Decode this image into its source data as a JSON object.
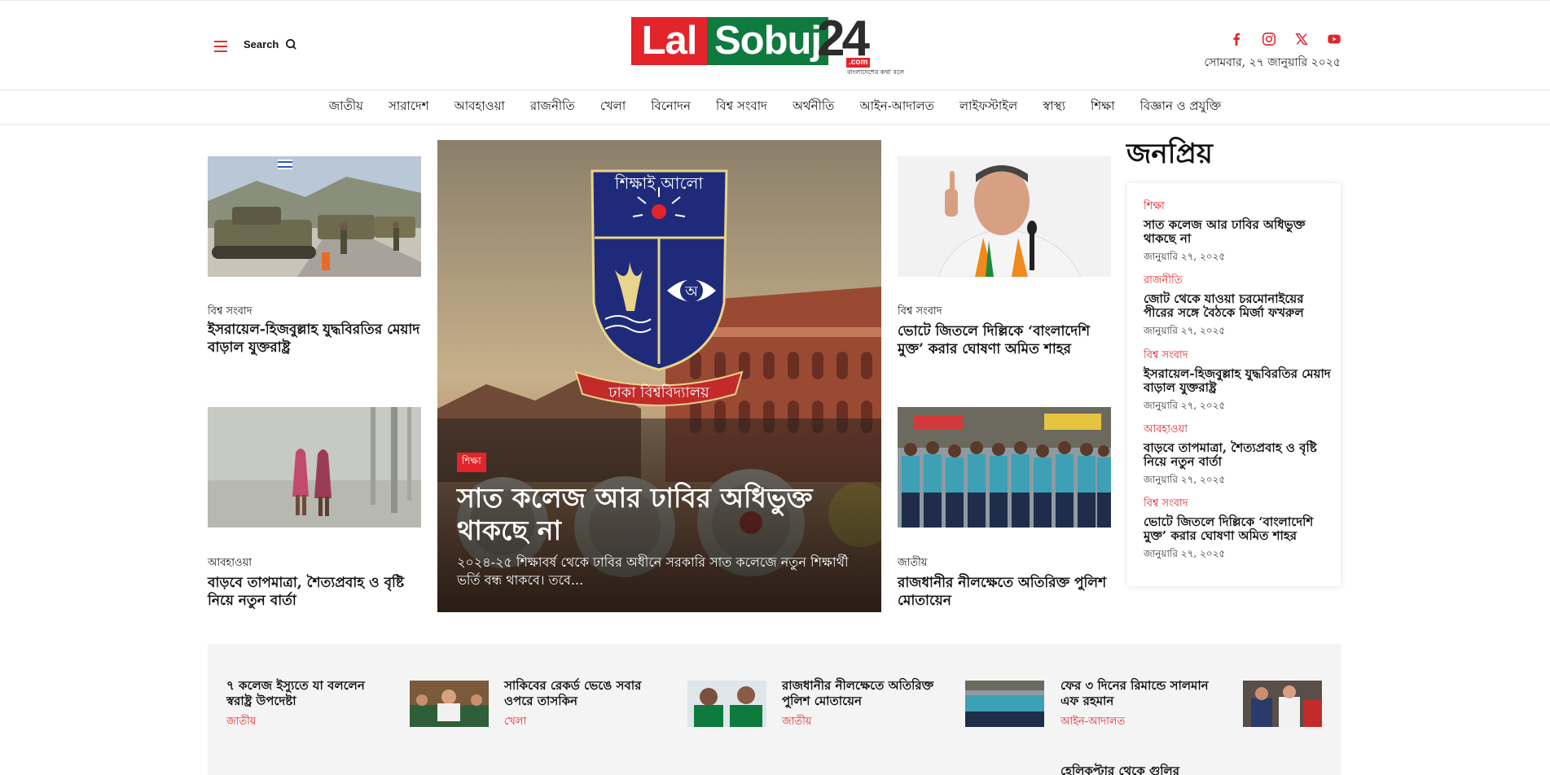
{
  "header": {
    "search_label": "Search",
    "logo": {
      "part1": "Lal",
      "part2": "Sobuj",
      "part3": "24",
      "suffix": ".com",
      "tagline": "বাংলাদেশের কথা বলে"
    },
    "date": "সোমবার, ২৭ জানুয়ারি ২০২৫",
    "social": [
      "facebook-icon",
      "instagram-icon",
      "x-icon",
      "youtube-icon"
    ]
  },
  "nav": [
    "জাতীয়",
    "সারাদেশ",
    "আবহাওয়া",
    "রাজনীতি",
    "খেলা",
    "বিনোদন",
    "বিশ্ব সংবাদ",
    "অর্থনীতি",
    "আইন-আদালত",
    "লাইফস্টাইল",
    "স্বাস্থ্য",
    "শিক্ষা",
    "বিজ্ঞান ও প্রযুক্তি"
  ],
  "left_cards": [
    {
      "category": "বিশ্ব সংবাদ",
      "title": "ইসরায়েল-হিজবুল্লাহ যুদ্ধবিরতির মেয়াদ বাড়াল যুক্তরাষ্ট্র"
    },
    {
      "category": "আবহাওয়া",
      "title": "বাড়বে তাপমাত্রা, শৈত্যপ্রবাহ ও বৃষ্টি নিয়ে নতুন বার্তা"
    }
  ],
  "hero": {
    "category": "শিক্ষা",
    "title": "সাত কলেজ আর ঢাবির অধিভুক্ত থাকছে না",
    "excerpt": "২০২৪-২৫ শিক্ষাবর্ষ থেকে ঢাবির অধীনে সরকারি সাত কলেজে নতুন শিক্ষার্থী ভর্তি বন্ধ থাকবে। তবে...",
    "emblem_top": "শিক্ষাই আলো",
    "emblem_bottom": "ঢাকা বিশ্ববিদ্যালয়",
    "emblem_letter": "অ"
  },
  "right_cards": [
    {
      "category": "বিশ্ব সংবাদ",
      "title": "ভোটে জিতলে দিল্লিকে ‘বাংলাদেশি মুক্ত’ করার ঘোষণা অমিত শাহর"
    },
    {
      "category": "জাতীয়",
      "title": "রাজধানীর নীলক্ষেতে অতিরিক্ত পুলিশ মোতায়েন"
    }
  ],
  "popular": {
    "heading": "জনপ্রিয়",
    "items": [
      {
        "category": "শিক্ষা",
        "title": "সাত কলেজ আর ঢাবির অধিভুক্ত থাকছে না",
        "date": "জানুয়ারি ২৭, ২০২৫"
      },
      {
        "category": "রাজনীতি",
        "title": "জোট থেকে যাওয়া চরমোনাইয়ের পীরের সঙ্গে বৈঠকে মির্জা ফখরুল",
        "date": "জানুয়ারি ২৭, ২০২৫"
      },
      {
        "category": "বিশ্ব সংবাদ",
        "title": "ইসরায়েল-হিজবুল্লাহ যুদ্ধবিরতির মেয়াদ বাড়াল যুক্তরাষ্ট্র",
        "date": "জানুয়ারি ২৭, ২০২৫"
      },
      {
        "category": "আবহাওয়া",
        "title": "বাড়বে তাপমাত্রা, শৈত্যপ্রবাহ ও বৃষ্টি নিয়ে নতুন বার্তা",
        "date": "জানুয়ারি ২৭, ২০২৫"
      },
      {
        "category": "বিশ্ব সংবাদ",
        "title": "ভোটে জিতলে দিল্লিকে ‘বাংলাদেশি মুক্ত’ করার ঘোষণা অমিত শাহর",
        "date": "জানুয়ারি ২৭, ২০২৫"
      }
    ]
  },
  "strip": [
    {
      "title": "৭ কলেজ ইস্যুতে যা বললেন স্বরাষ্ট্র উপদেষ্টা",
      "category": "জাতীয়"
    },
    {
      "title": "সাকিবের রেকর্ড ভেঙে সবার ওপরে তাসকিন",
      "category": "খেলা"
    },
    {
      "title": "রাজধানীর নীলক্ষেতে অতিরিক্ত পুলিশ মোতায়েন",
      "category": "জাতীয়"
    },
    {
      "title": "ফের ৩ দিনের রিমান্ডে সালমান এফ রহমান",
      "category": "আইন-আদালত"
    }
  ],
  "strip_next": "হেলিকপ্টার থেকে গুলির"
}
